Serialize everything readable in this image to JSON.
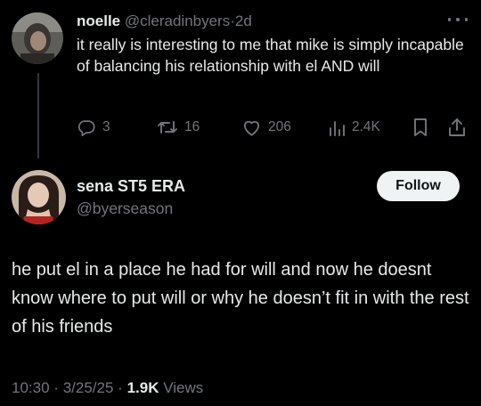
{
  "parent_tweet": {
    "display_name": "noelle",
    "handle": "@cleradinbyers",
    "separator": "·",
    "time": "2d",
    "text": "it really is interesting to me that mike is simply incapable of balancing his relationship with el AND will",
    "actions": {
      "replies": "3",
      "retweets": "16",
      "likes": "206",
      "views": "2.4K"
    },
    "icons": [
      "reply-icon",
      "retweet-icon",
      "like-icon",
      "views-icon",
      "bookmark-icon",
      "share-icon",
      "more-icon"
    ]
  },
  "main_tweet": {
    "display_name": "sena ST5 ERA",
    "handle": "@byerseason",
    "follow_label": "Follow",
    "text": "he put el in a place he had for will and now he doesnt know where to put will or why he doesn’t fit in with the rest of his friends",
    "time": "10:30",
    "dot": "·",
    "date": "3/25/25",
    "views_count": "1.9K",
    "views_label": "Views"
  },
  "colors": {
    "background": "#000000",
    "primary_text": "#e7e9ea",
    "secondary_text": "#71767b",
    "follow_button_bg": "#eff3f4",
    "thread_line": "#333639"
  }
}
